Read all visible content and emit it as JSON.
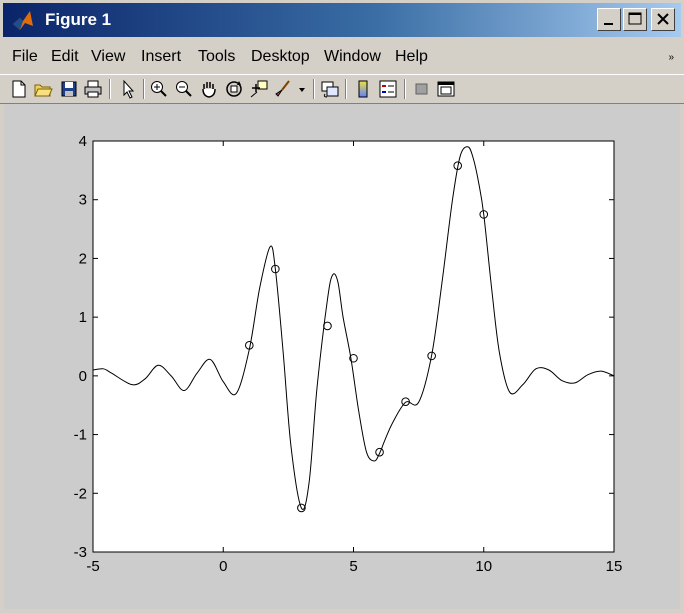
{
  "window": {
    "title": "Figure 1",
    "controls": [
      "minimize",
      "maximize",
      "close"
    ]
  },
  "menu": {
    "items": [
      "File",
      "Edit",
      "View",
      "Insert",
      "Tools",
      "Desktop",
      "Window",
      "Help"
    ]
  },
  "toolbar": {
    "icons": [
      "new-figure-icon",
      "open-file-icon",
      "save-icon",
      "print-icon",
      "pointer-icon",
      "zoom-in-icon",
      "zoom-out-icon",
      "pan-hand-icon",
      "rotate-3d-icon",
      "data-cursor-icon",
      "brush-icon",
      "brush-dropdown-icon",
      "link-plot-icon",
      "colorbar-icon",
      "legend-icon",
      "hide-plot-tools-icon",
      "show-plot-tools-icon"
    ]
  },
  "colors": {
    "titlebar_start": "#0a246a",
    "titlebar_end": "#a6caf0",
    "figure_background": "#cccccc",
    "axes_background": "#ffffff",
    "line": "#000000"
  },
  "chart_data": {
    "type": "line",
    "title": "",
    "xlabel": "",
    "ylabel": "",
    "xlim": [
      -5,
      15
    ],
    "ylim": [
      -3,
      4
    ],
    "xticks": [
      -5,
      0,
      5,
      10,
      15
    ],
    "yticks": [
      -3,
      -2,
      -1,
      0,
      1,
      2,
      3,
      4
    ],
    "grid": false,
    "series": [
      {
        "style": "line",
        "x": [
          -5,
          -4.6,
          -4.3,
          -3.5,
          -3,
          -2.5,
          -2,
          -1.5,
          -1,
          -0.5,
          0,
          0.5,
          1,
          1.4,
          1.8,
          2,
          2.3,
          2.6,
          3,
          3.3,
          3.6,
          4,
          4.2,
          4.4,
          4.6,
          4.9,
          5.2,
          5.5,
          5.8,
          6,
          6.2,
          6.5,
          7,
          7.5,
          8,
          8.4,
          8.8,
          9.1,
          9.4,
          9.6,
          9.8,
          10,
          10.3,
          10.6,
          11,
          11.5,
          12,
          12.5,
          13,
          13.5,
          14,
          14.5,
          15
        ],
        "y": [
          0.1,
          0.12,
          0.05,
          -0.15,
          -0.05,
          0.18,
          0.0,
          -0.25,
          0.05,
          0.28,
          -0.1,
          -0.3,
          0.45,
          1.5,
          2.2,
          1.82,
          0.4,
          -1.2,
          -2.25,
          -1.8,
          -0.2,
          1.3,
          1.72,
          1.6,
          1.0,
          0.3,
          -0.6,
          -1.3,
          -1.45,
          -1.32,
          -1.1,
          -0.8,
          -0.45,
          -0.45,
          0.35,
          1.6,
          3.0,
          3.75,
          3.9,
          3.7,
          3.3,
          2.75,
          1.5,
          0.4,
          -0.28,
          -0.15,
          0.12,
          0.1,
          -0.08,
          -0.12,
          0.02,
          0.08,
          0.0
        ]
      },
      {
        "style": "circle-markers",
        "x": [
          1,
          2,
          3,
          4,
          5,
          6,
          7,
          8,
          9,
          10
        ],
        "y": [
          0.52,
          1.82,
          -2.25,
          0.85,
          0.3,
          -1.3,
          -0.44,
          0.34,
          3.58,
          2.75
        ]
      }
    ]
  }
}
